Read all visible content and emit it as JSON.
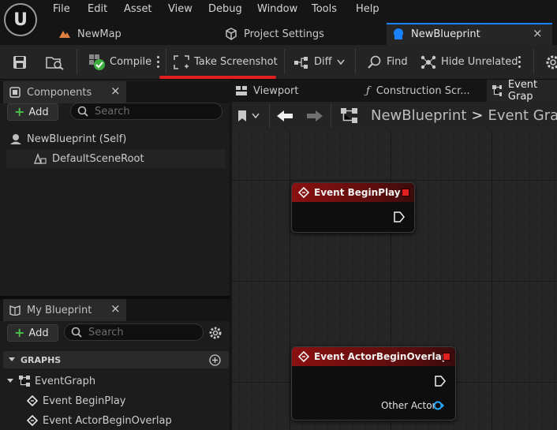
{
  "menu": [
    "File",
    "Edit",
    "Asset",
    "View",
    "Debug",
    "Window",
    "Tools",
    "Help"
  ],
  "tabs": {
    "newmap": "NewMap",
    "project_settings": "Project Settings",
    "new_blueprint": "NewBlueprint",
    "close": "×"
  },
  "toolbar": {
    "compile": "Compile",
    "take_screenshot": "Take Screenshot",
    "diff": "Diff",
    "find": "Find",
    "hide_unrelated": "Hide Unrelated"
  },
  "components_panel": {
    "title": "Components",
    "close": "×",
    "add": "Add",
    "search_placeholder": "Search",
    "items": [
      "NewBlueprint (Self)",
      "DefaultSceneRoot"
    ]
  },
  "my_blueprint_panel": {
    "title": "My Blueprint",
    "close": "×",
    "add": "Add",
    "search_placeholder": "Search",
    "section": "GRAPHS",
    "graph": "EventGraph",
    "events": [
      "Event BeginPlay",
      "Event ActorBeginOverlap"
    ]
  },
  "graph_tabs": {
    "viewport": "Viewport",
    "construction": "Construction Scr...",
    "event_graph": "Event Grap"
  },
  "breadcrumb": {
    "blueprint": "NewBlueprint",
    "separator": ">",
    "graph": "Event Graph"
  },
  "nodes": {
    "begin_play": "Event BeginPlay",
    "actor_begin_overlap": "Event ActorBeginOverlap",
    "other_actor_pin": "Other Actor"
  },
  "colors": {
    "accent": "#1a82ff",
    "event_node_header": "#8a1111",
    "highlight_underline": "#e0201e",
    "add_plus": "#4cc24c",
    "object_pin": "#2aa8ff"
  }
}
